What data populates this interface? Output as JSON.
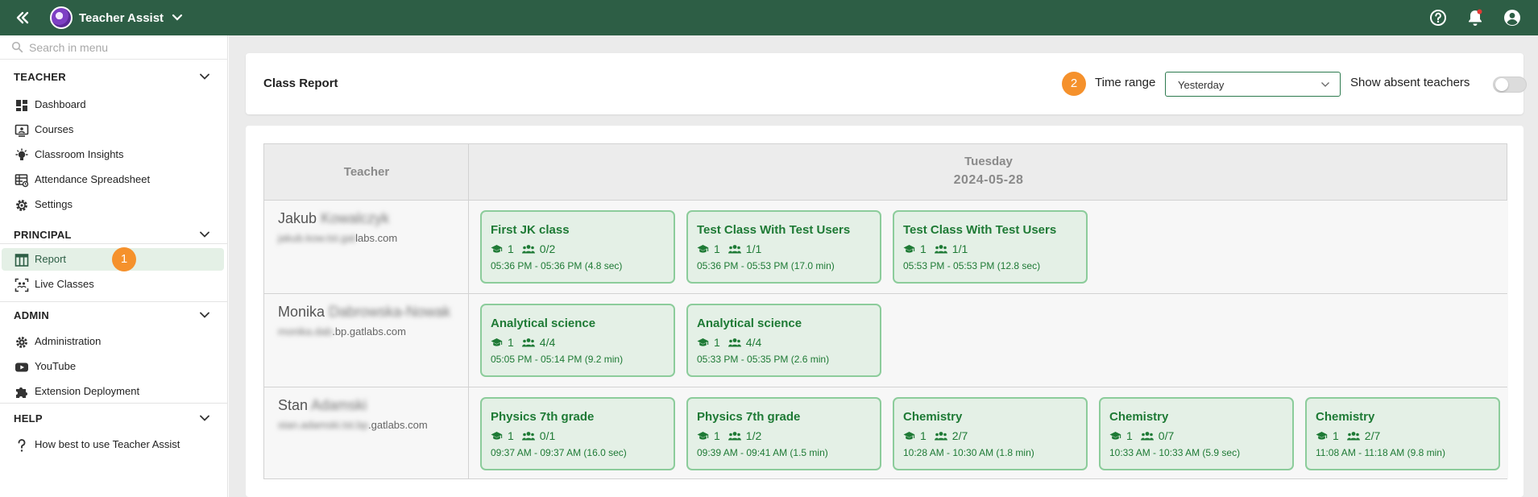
{
  "topbar": {
    "app_name": "Teacher Assist",
    "icons": [
      "collapse-icon",
      "help-icon",
      "notification-icon",
      "account-icon"
    ],
    "brand_color": "#2d5e45"
  },
  "sidebar": {
    "search_placeholder": "Search in menu",
    "sections": [
      {
        "title": "TEACHER",
        "items": [
          {
            "label": "Dashboard",
            "icon": "dashboard-icon"
          },
          {
            "label": "Courses",
            "icon": "courses-icon"
          },
          {
            "label": "Classroom Insights",
            "icon": "lightbulb-icon"
          },
          {
            "label": "Attendance Spreadsheet",
            "icon": "spreadsheet-icon"
          },
          {
            "label": "Settings",
            "icon": "gear-icon"
          }
        ]
      },
      {
        "title": "PRINCIPAL",
        "items": [
          {
            "label": "Report",
            "icon": "report-icon",
            "active": true,
            "step": "1"
          },
          {
            "label": "Live Classes",
            "icon": "live-classes-icon"
          }
        ]
      },
      {
        "title": "ADMIN",
        "items": [
          {
            "label": "Administration",
            "icon": "gear-icon"
          },
          {
            "label": "YouTube",
            "icon": "youtube-icon"
          },
          {
            "label": "Extension Deployment",
            "icon": "puzzle-icon"
          }
        ]
      },
      {
        "title": "HELP",
        "items": [
          {
            "label": "How best to use Teacher Assist",
            "icon": "question-icon"
          }
        ]
      }
    ]
  },
  "header": {
    "title": "Class Report",
    "step": "2",
    "time_range_label": "Time range",
    "time_range_value": "Yesterday",
    "show_absent_label": "Show absent teachers",
    "show_absent_on": false
  },
  "report": {
    "teacher_header": "Teacher",
    "weekday": "Tuesday",
    "date": "2024-05-28",
    "rows": [
      {
        "first_name": "Jakub",
        "last_name_redacted": "Kowalczyk",
        "email_redacted": "jakub.kow.tst.gat",
        "email_visible": "labs.com",
        "classes": [
          {
            "title": "First JK class",
            "courses": "1",
            "attendance": "0/2",
            "time": "05:36 PM - 05:36 PM (4.8 sec)"
          },
          {
            "title": "Test Class With Test Users",
            "courses": "1",
            "attendance": "1/1",
            "time": "05:36 PM - 05:53 PM (17.0 min)"
          },
          {
            "title": "Test Class With Test Users",
            "courses": "1",
            "attendance": "1/1",
            "time": "05:53 PM - 05:53 PM (12.8 sec)"
          }
        ]
      },
      {
        "first_name": "Monika",
        "last_name_redacted": "Dabrowska-Nowak",
        "email_redacted": "monika.dab",
        "email_visible": ".bp.gatlabs.com",
        "classes": [
          {
            "title": "Analytical science",
            "courses": "1",
            "attendance": "4/4",
            "time": "05:05 PM - 05:14 PM (9.2 min)"
          },
          {
            "title": "Analytical science",
            "courses": "1",
            "attendance": "4/4",
            "time": "05:33 PM - 05:35 PM (2.6 min)"
          }
        ]
      },
      {
        "first_name": "Stan",
        "last_name_redacted": "Adamski",
        "email_redacted": "stan.adamski.tst.bp",
        "email_visible": ".gatlabs.com",
        "classes": [
          {
            "title": "Physics 7th grade",
            "courses": "1",
            "attendance": "0/1",
            "time": "09:37 AM - 09:37 AM (16.0 sec)"
          },
          {
            "title": "Physics 7th grade",
            "courses": "1",
            "attendance": "1/2",
            "time": "09:39 AM - 09:41 AM (1.5 min)"
          },
          {
            "title": "Chemistry",
            "courses": "1",
            "attendance": "2/7",
            "time": "10:28 AM - 10:30 AM (1.8 min)"
          },
          {
            "title": "Chemistry",
            "courses": "1",
            "attendance": "0/7",
            "time": "10:33 AM - 10:33 AM (5.9 sec)"
          },
          {
            "title": "Chemistry",
            "courses": "1",
            "attendance": "2/7",
            "time": "11:08 AM - 11:18 AM (9.8 min)"
          }
        ]
      }
    ]
  },
  "colors": {
    "class_card_bg": "#e4f0e6",
    "class_card_border": "#8ccc9b",
    "class_card_text": "#1e7a35",
    "step_badge": "#f5912c"
  }
}
